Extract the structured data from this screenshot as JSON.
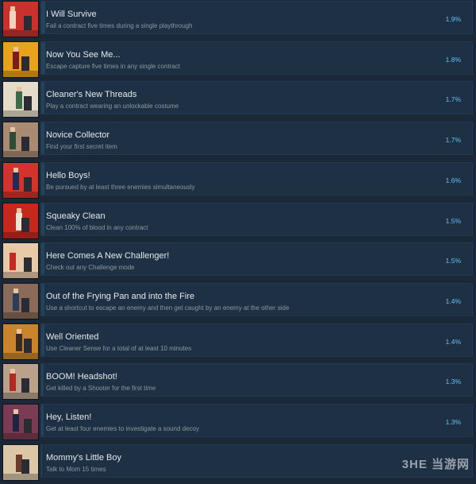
{
  "achievements": [
    {
      "title": "I Will Survive",
      "description": "Fail a contract five times during a single playthrough",
      "percent": "1.9%",
      "progress": 0.019,
      "thumb_bg": "#c8312c",
      "accent": "#f2d3bd"
    },
    {
      "title": "Now You See Me...",
      "description": "Escape capture five times in any single contract",
      "percent": "1.8%",
      "progress": 0.018,
      "thumb_bg": "#e8a21b",
      "accent": "#7c1b1b"
    },
    {
      "title": "Cleaner's New Threads",
      "description": "Play a contract wearing an unlockable costume",
      "percent": "1.7%",
      "progress": 0.017,
      "thumb_bg": "#e4dcc8",
      "accent": "#3c6a4a"
    },
    {
      "title": "Novice Collector",
      "description": "Find your first secret item",
      "percent": "1.7%",
      "progress": 0.017,
      "thumb_bg": "#a98a72",
      "accent": "#2f4c3a"
    },
    {
      "title": "Hello Boys!",
      "description": "Be pursued by at least three enemies simultaneously",
      "percent": "1.6%",
      "progress": 0.016,
      "thumb_bg": "#d2332a",
      "accent": "#1f2d55"
    },
    {
      "title": "Squeaky Clean",
      "description": "Clean 100% of blood in any contract",
      "percent": "1.5%",
      "progress": 0.015,
      "thumb_bg": "#c7281e",
      "accent": "#f0e2d0"
    },
    {
      "title": "Here Comes A New Challenger!",
      "description": "Check out any Challenge mode",
      "percent": "1.5%",
      "progress": 0.015,
      "thumb_bg": "#e8c9a8",
      "accent": "#c52a22"
    },
    {
      "title": "Out of the Frying Pan and into the Fire",
      "description": "Use a shortcut to escape an enemy and then get caught by an enemy at the other side",
      "percent": "1.4%",
      "progress": 0.014,
      "thumb_bg": "#8a6a58",
      "accent": "#2a3d5a"
    },
    {
      "title": "Well Oriented",
      "description": "Use Cleaner Sense for a total of at least 10 minutes",
      "percent": "1.4%",
      "progress": 0.014,
      "thumb_bg": "#c9842c",
      "accent": "#3a2a1e"
    },
    {
      "title": "BOOM! Headshot!",
      "description": "Get killed by a Shooter for the first time",
      "percent": "1.3%",
      "progress": 0.013,
      "thumb_bg": "#b9a18c",
      "accent": "#b12a22"
    },
    {
      "title": "Hey, Listen!",
      "description": "Get at least four enemies to investigate a sound decoy",
      "percent": "1.3%",
      "progress": 0.013,
      "thumb_bg": "#7b3b52",
      "accent": "#1e2340"
    },
    {
      "title": "Mommy's Little Boy",
      "description": "Talk to Mom 15 times",
      "percent": "",
      "progress": 0,
      "thumb_bg": "#d9c7a8",
      "accent": "#6a3a2a"
    }
  ],
  "watermark": "3HE 当游网"
}
